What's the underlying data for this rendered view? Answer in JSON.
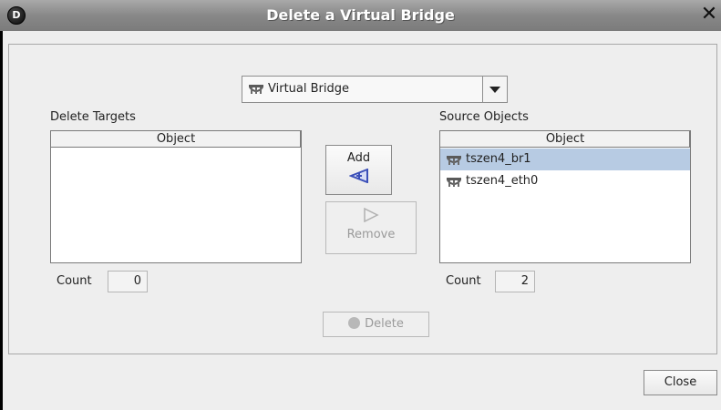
{
  "window": {
    "title": "Delete a Virtual Bridge",
    "app_icon_letter": "D"
  },
  "selector": {
    "selected_value": "Virtual Bridge",
    "icon": "virtual-bridge-icon"
  },
  "delete_targets": {
    "label": "Delete Targets",
    "column_header": "Object",
    "items": [],
    "count_label": "Count",
    "count_value": "0"
  },
  "source_objects": {
    "label": "Source Objects",
    "column_header": "Object",
    "items": [
      {
        "name": "tszen4_br1",
        "selected": true
      },
      {
        "name": "tszen4_eth0",
        "selected": false
      }
    ],
    "count_label": "Count",
    "count_value": "2"
  },
  "buttons": {
    "add": "Add",
    "remove": "Remove",
    "delete": "Delete",
    "close": "Close"
  },
  "colors": {
    "titlebar": "#8c8c8c",
    "selection": "#b7cbe3",
    "add_arrow": "#3b4fb8"
  }
}
